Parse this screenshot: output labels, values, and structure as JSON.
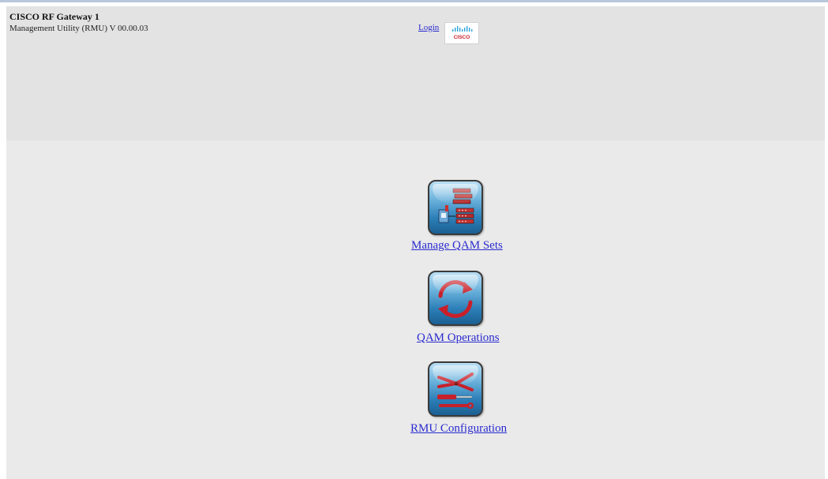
{
  "header": {
    "title": "CISCO RF Gateway 1",
    "version": "Management Utility (RMU) V 00.00.03",
    "login_label": "Login",
    "logo_text": "CISCO"
  },
  "tiles": [
    {
      "label": "Manage QAM Sets",
      "icon": "manage-qam-sets-icon"
    },
    {
      "label": "QAM Operations",
      "icon": "qam-operations-icon"
    },
    {
      "label": "RMU Configuration",
      "icon": "rmu-configuration-icon"
    }
  ],
  "colors": {
    "link": "#2a2ad0",
    "header_bg": "#e3e3e3",
    "body_bg": "#eaeaea",
    "icon_blue": "#2c7fb8",
    "icon_red": "#c8202a"
  }
}
